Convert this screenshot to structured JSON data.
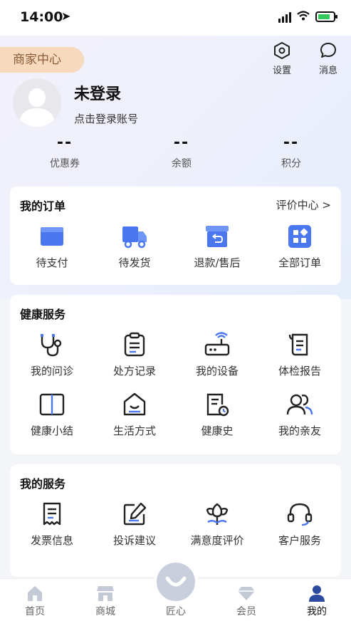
{
  "status": {
    "time": "14:00"
  },
  "header": {
    "merchant_label": "商家中心",
    "settings_label": "设置",
    "messages_label": "消息"
  },
  "user": {
    "name": "未登录",
    "subtitle": "点击登录账号"
  },
  "stats": [
    {
      "value": "--",
      "label": "优惠券"
    },
    {
      "value": "--",
      "label": "余额"
    },
    {
      "value": "--",
      "label": "积分"
    }
  ],
  "orders": {
    "title": "我的订单",
    "link": "评价中心 >",
    "items": [
      {
        "label": "待支付",
        "icon": "wallet-icon"
      },
      {
        "label": "待发货",
        "icon": "truck-icon"
      },
      {
        "label": "退款/售后",
        "icon": "return-box-icon"
      },
      {
        "label": "全部订单",
        "icon": "grid-icon"
      }
    ]
  },
  "health": {
    "title": "健康服务",
    "items": [
      {
        "label": "我的问诊",
        "icon": "stethoscope-icon"
      },
      {
        "label": "处方记录",
        "icon": "clipboard-icon"
      },
      {
        "label": "我的设备",
        "icon": "router-icon"
      },
      {
        "label": "体检报告",
        "icon": "scroll-icon"
      },
      {
        "label": "健康小结",
        "icon": "book-icon"
      },
      {
        "label": "生活方式",
        "icon": "house-smile-icon"
      },
      {
        "label": "健康史",
        "icon": "history-doc-icon"
      },
      {
        "label": "我的亲友",
        "icon": "friends-icon"
      }
    ]
  },
  "services": {
    "title": "我的服务",
    "items": [
      {
        "label": "发票信息",
        "icon": "invoice-icon"
      },
      {
        "label": "投诉建议",
        "icon": "edit-icon"
      },
      {
        "label": "满意度评价",
        "icon": "flower-icon"
      },
      {
        "label": "客户服务",
        "icon": "headset-icon"
      }
    ]
  },
  "tabbar": {
    "items": [
      {
        "label": "首页",
        "icon": "home-icon"
      },
      {
        "label": "商城",
        "icon": "store-icon"
      },
      {
        "label": "匠心",
        "icon": "smile-icon"
      },
      {
        "label": "会员",
        "icon": "diamond-icon"
      },
      {
        "label": "我的",
        "icon": "user-icon"
      }
    ],
    "active": "我的"
  },
  "colors": {
    "accent_blue": "#4a76f0",
    "merchant_bg": "#f7d9bd",
    "active_tab": "#2b4aa0"
  }
}
